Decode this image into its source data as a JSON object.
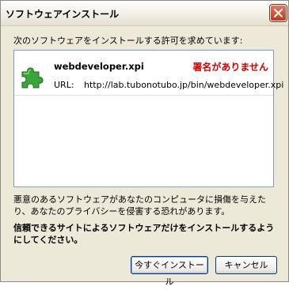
{
  "window": {
    "title": "ソフトウェアインストール"
  },
  "prompt": "次のソフトウェアをインストールする許可を求めています:",
  "items": [
    {
      "name": "webdeveloper.xpi",
      "status": "署名がありません",
      "url_label": "URL:",
      "url": "http://lab.tubonotubo.jp/bin/webdeveloper.xpi",
      "icon": "puzzle-piece-icon"
    }
  ],
  "warning": "悪意のあるソフトウェアがあなたのコンピュータに損傷を与えたり、あなたのプライバシーを侵害する恐れがあります。",
  "advice": "信頼できるサイトによるソフトウェアだけをインストールするようにしてください。",
  "buttons": {
    "install": "今すぐインストール",
    "cancel": "キャンセル"
  },
  "colors": {
    "unsigned_status": "#d40000",
    "close_button": "#c2391d",
    "dialog_bg": "#ece9d8"
  }
}
